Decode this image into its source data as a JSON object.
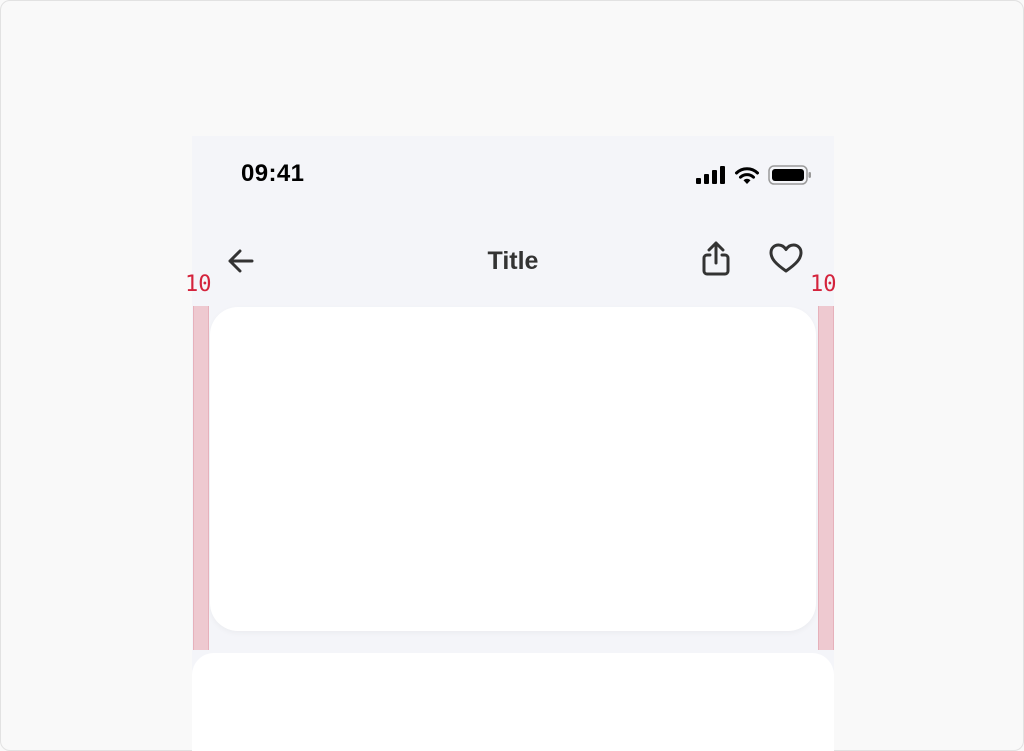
{
  "status_bar": {
    "time": "09:41",
    "icons": [
      "cellular-signal-icon",
      "wifi-icon",
      "battery-icon"
    ]
  },
  "nav_bar": {
    "title": "Title",
    "icons": [
      "arrow-left-icon",
      "share-icon",
      "heart-icon"
    ]
  },
  "annotations": {
    "left_spacing": "10",
    "right_spacing": "10",
    "guide_color": "#d4233c"
  },
  "colors": {
    "background": "#f4f5f9",
    "card": "#ffffff",
    "text": "#333333"
  }
}
